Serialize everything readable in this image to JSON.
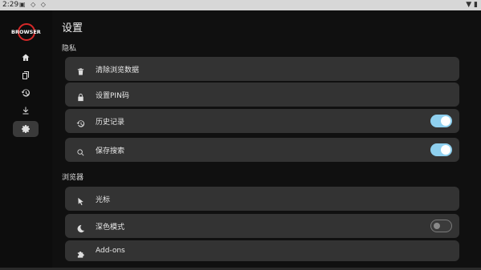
{
  "status_bar": {
    "time": "2:29",
    "icons": [
      "notification-icons"
    ],
    "wifi": "wifi-icon",
    "battery": "battery-icon"
  },
  "app": {
    "logo_text": "BROWSER"
  },
  "rail": {
    "items": [
      {
        "icon": "home-icon",
        "active": false
      },
      {
        "icon": "tabs-icon",
        "active": false
      },
      {
        "icon": "history-icon",
        "active": false
      },
      {
        "icon": "download-icon",
        "active": false
      },
      {
        "icon": "settings-icon",
        "active": true
      }
    ]
  },
  "page": {
    "title": "设置"
  },
  "sections": [
    {
      "title": "隐私",
      "items": [
        {
          "icon": "trash-icon",
          "label": "清除浏览数据"
        },
        {
          "icon": "lock-icon",
          "label": "设置PIN码"
        },
        {
          "icon": "history-icon",
          "label": "历史记录",
          "toggle": true
        },
        {
          "icon": "search-icon",
          "label": "保存搜索",
          "toggle": true
        }
      ]
    },
    {
      "title": "浏览器",
      "items": [
        {
          "icon": "cursor-icon",
          "label": "光标"
        },
        {
          "icon": "moon-icon",
          "label": "深色模式",
          "toggle": false
        },
        {
          "icon": "puzzle-icon",
          "label": "Add-ons"
        }
      ]
    }
  ],
  "colors": {
    "toggle_on": "#8fd0ef",
    "row_bg": "#333333",
    "bg": "#101010",
    "logo_red": "#d62828"
  }
}
